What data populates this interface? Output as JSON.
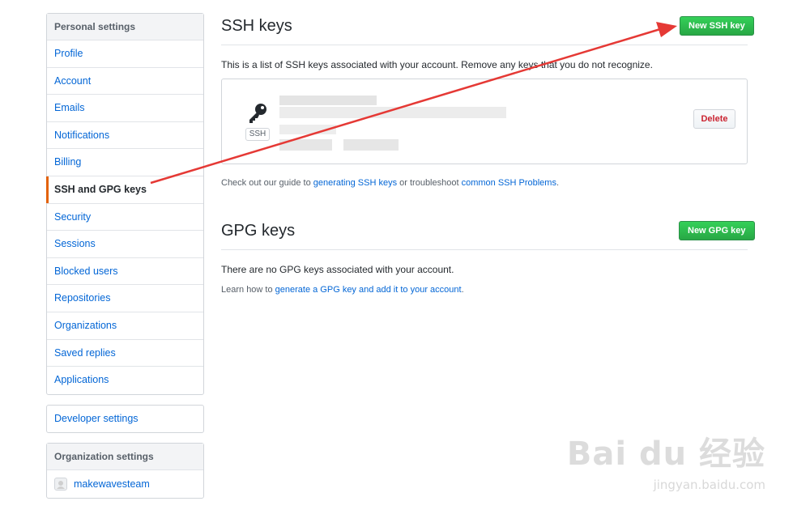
{
  "sidebar": {
    "heading": "Personal settings",
    "items": [
      {
        "label": "Profile"
      },
      {
        "label": "Account"
      },
      {
        "label": "Emails"
      },
      {
        "label": "Notifications"
      },
      {
        "label": "Billing"
      },
      {
        "label": "SSH and GPG keys",
        "selected": true
      },
      {
        "label": "Security"
      },
      {
        "label": "Sessions"
      },
      {
        "label": "Blocked users"
      },
      {
        "label": "Repositories"
      },
      {
        "label": "Organizations"
      },
      {
        "label": "Saved replies"
      },
      {
        "label": "Applications"
      }
    ],
    "developer": "Developer settings",
    "org_heading": "Organization settings",
    "org_name": "makewavesteam"
  },
  "ssh": {
    "title": "SSH keys",
    "new_button": "New SSH key",
    "description": "This is a list of SSH keys associated with your account. Remove any keys that you do not recognize.",
    "key_type": "SSH",
    "delete_button": "Delete",
    "guide_prefix": "Check out our guide to ",
    "guide_link": "generating SSH keys",
    "guide_middle": " or troubleshoot ",
    "guide_link2": "common SSH Problems",
    "guide_suffix": "."
  },
  "gpg": {
    "title": "GPG keys",
    "new_button": "New GPG key",
    "empty": "There are no GPG keys associated with your account.",
    "learn_prefix": "Learn how to ",
    "learn_link": "generate a GPG key and add it to your account",
    "learn_suffix": "."
  },
  "colors": {
    "accent_link": "#0366d6",
    "green": "#28a745",
    "selected_bar": "#e36209",
    "annotation_arrow": "#e53935"
  },
  "watermark": {
    "brand": "Bai du 经验",
    "url": "jingyan.baidu.com"
  }
}
